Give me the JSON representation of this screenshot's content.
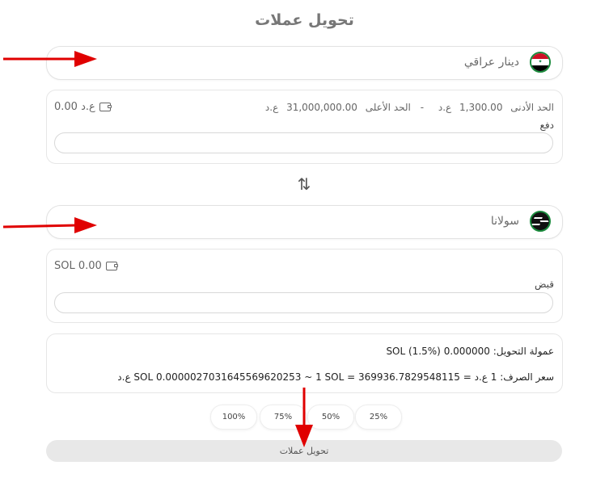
{
  "page_title": "تحويل عملات",
  "from": {
    "currency_name": "دينار عراقي",
    "limit_min_label": "الحد الأدنى",
    "limit_min_value": "1,300.00",
    "limit_unit": "ع.د",
    "limit_sep": "-",
    "limit_max_label": "الحد الأعلى",
    "limit_max_value": "31,000,000.00",
    "balance": "0.00 ع.د",
    "field_label": "دفع",
    "flag_icon": "iraq-flag-icon"
  },
  "swap_symbol": "⇅",
  "to": {
    "currency_name": "سولانا",
    "balance": "SOL 0.00",
    "field_label": "قبض",
    "logo_icon": "solana-logo-icon"
  },
  "info": {
    "fee_text": "عمولة التحويل: 0.000000 SOL (1.5%)",
    "rate_text": "سعر الصرف: 1 ع.د = SOL 0.0000027031645569620253 ~ 1 SOL = 369936.7829548115 ع.د"
  },
  "percent_buttons": [
    "100%",
    "75%",
    "50%",
    "25%"
  ],
  "convert_label": "تحويل عملات",
  "colors": {
    "arrow": "#e00000",
    "flag_border": "#1a8a3c"
  }
}
